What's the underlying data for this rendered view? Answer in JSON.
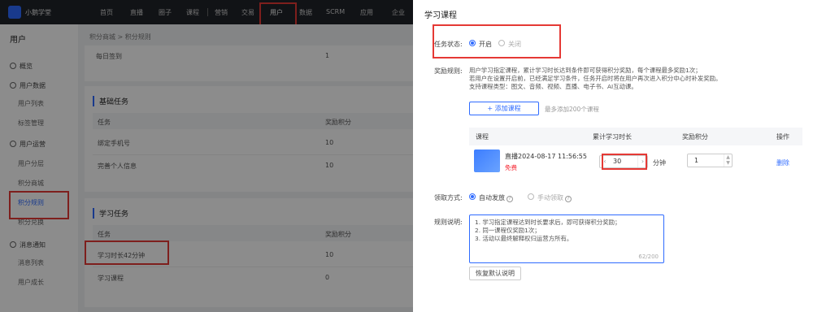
{
  "app": {
    "brand": "小鹅学堂"
  },
  "nav": [
    "首页",
    "直播",
    "圈子",
    "课程",
    "营销",
    "交易",
    "用户",
    "数据",
    "SCRM",
    "应用",
    "企业"
  ],
  "sidebar": {
    "title": "用户",
    "overview": "概览",
    "group_data": "用户数据",
    "items_data": [
      "用户列表",
      "标签管理"
    ],
    "group_ops": "用户运营",
    "items_ops": [
      "用户分层",
      "积分商城",
      "积分规则",
      "积分兑换"
    ],
    "group_service": "消息通知",
    "items_service": [
      "消息列表",
      "用户成长"
    ]
  },
  "main": {
    "breadcrumb": "积分商城 > 积分规则",
    "top_row": {
      "name": "每日签到",
      "points": "1"
    },
    "basic": {
      "title": "基础任务",
      "headers": [
        "任务",
        "奖励积分"
      ],
      "rows": [
        {
          "task": "绑定手机号",
          "points": "10"
        },
        {
          "task": "完善个人信息",
          "points": "10"
        }
      ]
    },
    "learn": {
      "title": "学习任务",
      "headers": [
        "任务",
        "奖励积分"
      ],
      "rows": [
        {
          "task": "学习时长42分钟",
          "points": "10"
        },
        {
          "task": "学习课程",
          "points": "0"
        }
      ]
    }
  },
  "drawer": {
    "title": "学习课程",
    "status_label": "任务状态:",
    "status_on": "开启",
    "status_off": "关闭",
    "rule_label": "奖励规则:",
    "rule_lines": [
      "用户学习指定课程，累计学习时长达到条件即可获得积分奖励，每个课程最多奖励1次；",
      "若用户在设置开启前，已经满足学习条件，任务开启时将在用户再次进入积分中心时补发奖励。",
      "支持课程类型：图文、音频、视频、直播、电子书、AI互动课。"
    ],
    "add_button": "+ 添加课程",
    "add_tip": "最多添加200个课程",
    "table_headers": [
      "课程",
      "累计学习时长",
      "奖励积分",
      "操作"
    ],
    "course": {
      "name": "直播2024-08-17 11:56:55",
      "tag": "免费",
      "duration": "30",
      "unit": "分钟",
      "points": "1",
      "action": "删除"
    },
    "claim_label": "领取方式:",
    "claim_auto": "自动发放",
    "claim_manual": "手动领取",
    "desc_label": "规则说明:",
    "desc_lines": [
      "1. 学习指定课程达到时长要求后，即可获得积分奖励；",
      "2. 同一课程仅奖励1次；",
      "3. 活动以最终解释权归运营方所有。"
    ],
    "desc_counter": "62/200",
    "default_button": "恢复默认说明"
  },
  "colors": {
    "accent": "#2f6bff",
    "highlight": "#e53935",
    "topbar": "#1f2329"
  }
}
